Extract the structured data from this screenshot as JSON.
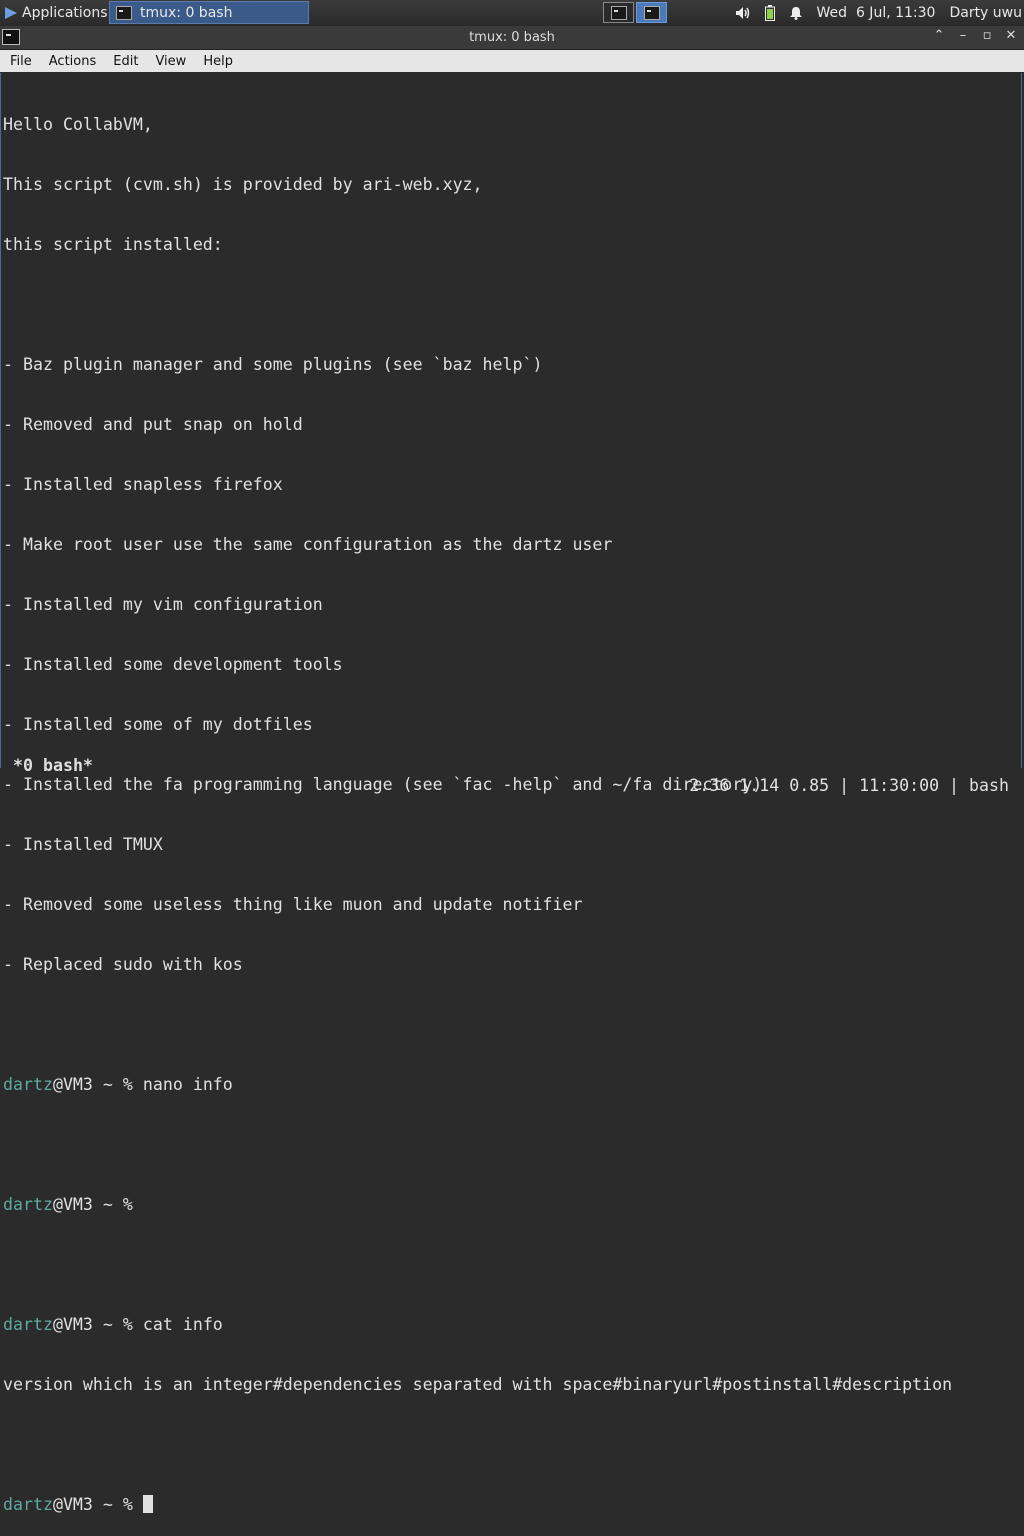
{
  "panel": {
    "applications_label": "Applications",
    "task_label": "tmux: 0 bash",
    "clock": "Wed  6 Jul, 11:30",
    "user": "Darty uwu"
  },
  "window": {
    "title": "tmux: 0 bash"
  },
  "menu": {
    "file": "File",
    "actions": "Actions",
    "edit": "Edit",
    "view": "View",
    "help": "Help"
  },
  "terminal": {
    "lines": [
      "Hello CollabVM,",
      "This script (cvm.sh) is provided by ari-web.xyz,",
      "this script installed:",
      "",
      "- Baz plugin manager and some plugins (see `baz help`)",
      "- Removed and put snap on hold",
      "- Installed snapless firefox",
      "- Make root user use the same configuration as the dartz user",
      "- Installed my vim configuration",
      "- Installed some development tools",
      "- Installed some of my dotfiles",
      "- Installed the fa programming language (see `fac -help` and ~/fa directory)",
      "- Installed TMUX",
      "- Removed some useless thing like muon and update notifier",
      "- Replaced sudo with kos"
    ],
    "prompt_user": "dartz",
    "prompt_rest": "@VM3 ~ % ",
    "cmd1": "nano info",
    "cmd2": "",
    "cmd3": "cat info",
    "output3": "version which is an integer#dependencies separated with space#binaryurl#postinstall#description",
    "cmd4": ""
  },
  "statusbar": {
    "window_label": "*0 bash*",
    "right": "2.36 1.14 0.85 | 11:30:00 | bash"
  },
  "colors": {
    "prompt": "#5fa8a0",
    "background": "#2b2b2b"
  }
}
